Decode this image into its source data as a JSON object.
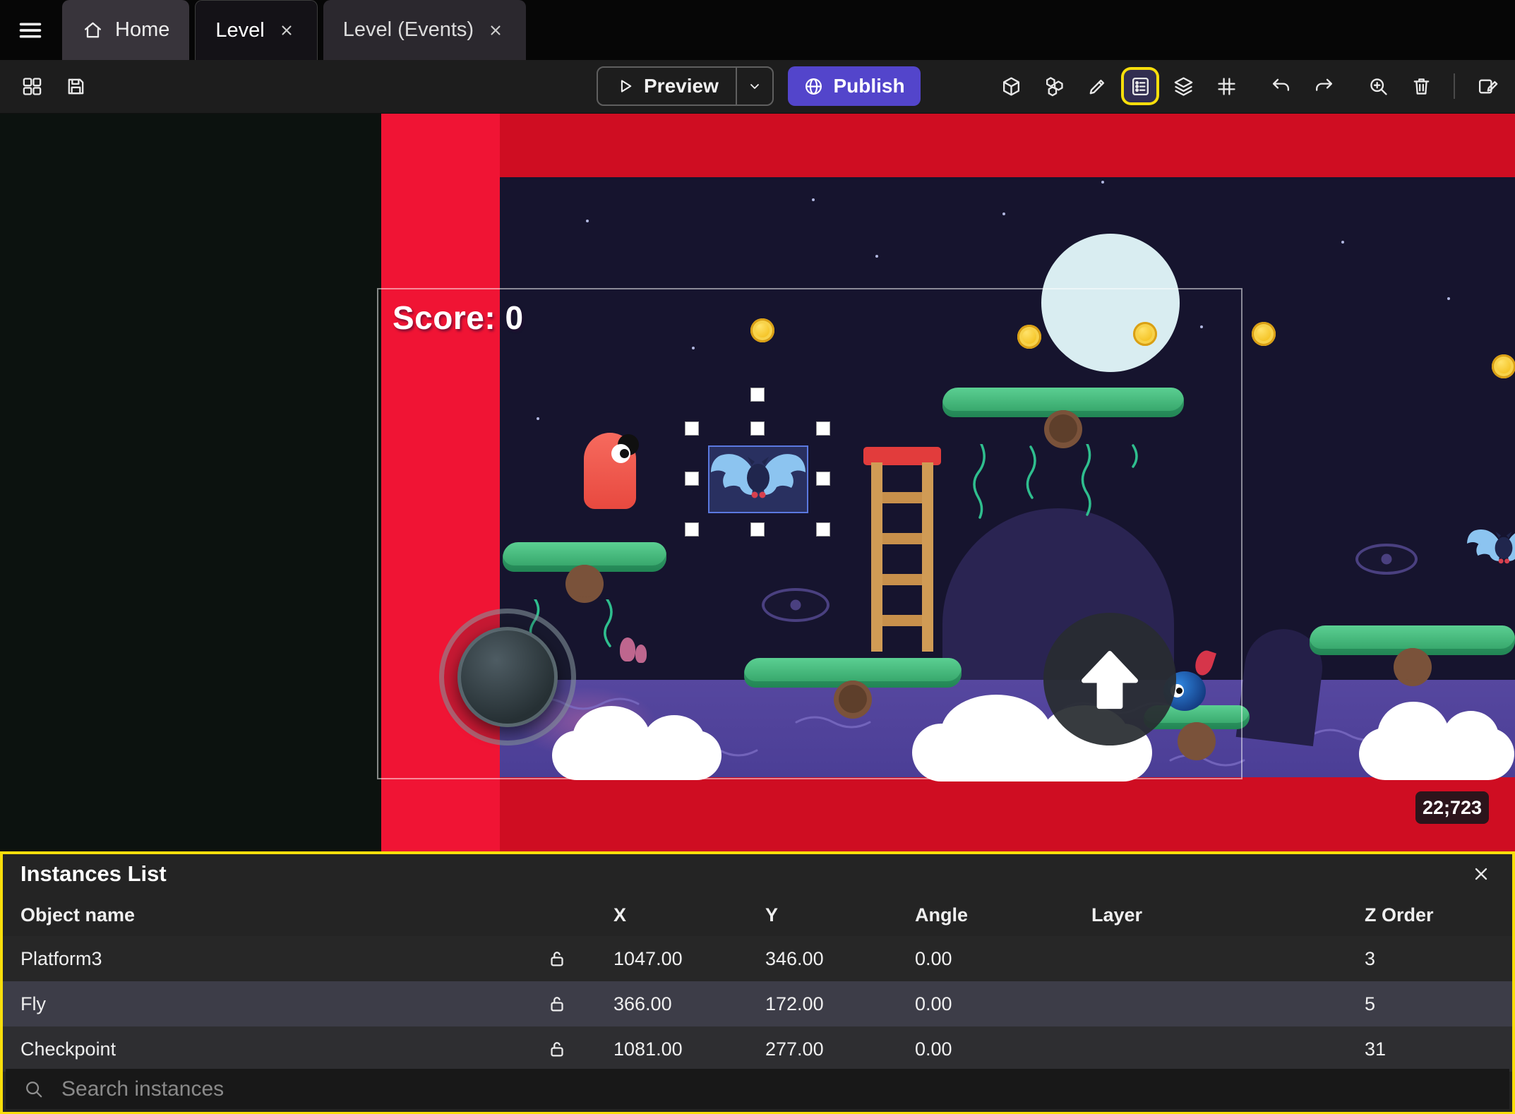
{
  "tabs": {
    "home": "Home",
    "level": "Level",
    "level_events": "Level (Events)"
  },
  "toolbar": {
    "preview": "Preview",
    "publish": "Publish"
  },
  "scene": {
    "score": "Score: 0",
    "coords": "22;723"
  },
  "instances": {
    "title": "Instances List",
    "columns": [
      "Object name",
      "X",
      "Y",
      "Angle",
      "Layer",
      "Z Order"
    ],
    "rows": [
      {
        "name": "Platform3",
        "x": "1047.00",
        "y": "346.00",
        "angle": "0.00",
        "layer": "",
        "z_order": "3"
      },
      {
        "name": "Fly",
        "x": "366.00",
        "y": "172.00",
        "angle": "0.00",
        "layer": "",
        "z_order": "5"
      },
      {
        "name": "Checkpoint",
        "x": "1081.00",
        "y": "277.00",
        "angle": "0.00",
        "layer": "",
        "z_order": "31"
      }
    ],
    "search_placeholder": "Search instances"
  },
  "icons": {
    "menu": "hamburger",
    "home": "house",
    "close": "x-cross",
    "editors_layout": "panels-grid",
    "save": "floppy-disk",
    "play": "triangle-right",
    "dropdown": "chevron-down",
    "globe": "globe",
    "object": "cube",
    "objects_group": "cubes-cluster",
    "edit": "pencil",
    "instances_list": "list-with-bullets",
    "layers": "stacked-layers",
    "grid": "hash-grid",
    "undo": "arrow-curve-left",
    "redo": "arrow-curve-right",
    "zoom_in": "magnifier-plus",
    "delete": "trash-can",
    "edit_scene": "square-pencil",
    "unlock": "open-padlock",
    "search": "magnifier"
  },
  "colors": {
    "publish": "#5345cb",
    "highlight": "#f8de0b",
    "selection": "#5b79e0",
    "stripe_red": "#f01434",
    "scene_red": "#cf0d22",
    "sky_navy": "#16142e",
    "water": "#4b3e96"
  }
}
